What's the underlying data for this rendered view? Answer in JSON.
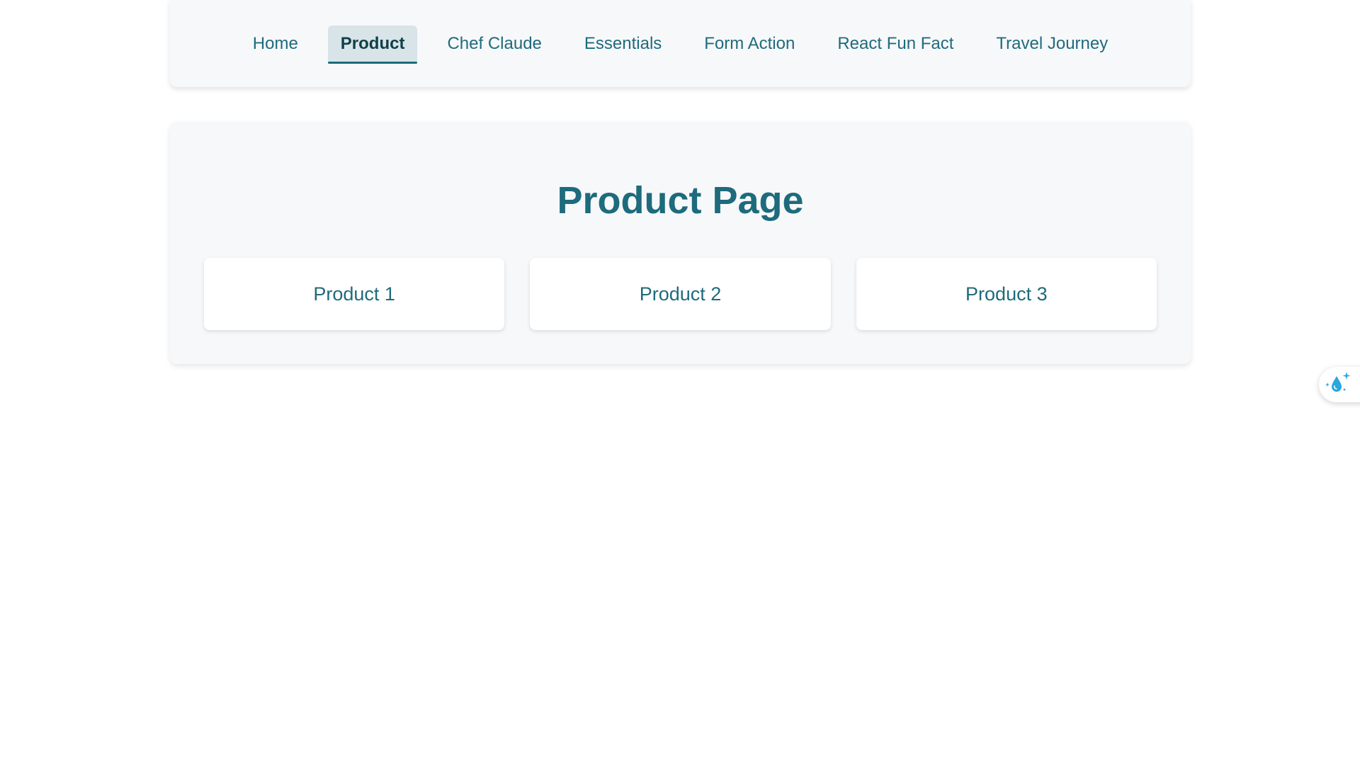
{
  "nav": {
    "items": [
      {
        "label": "Home"
      },
      {
        "label": "Product"
      },
      {
        "label": "Chef Claude"
      },
      {
        "label": "Essentials"
      },
      {
        "label": "Form Action"
      },
      {
        "label": "React Fun Fact"
      },
      {
        "label": "Travel Journey"
      }
    ],
    "active_index": 1
  },
  "main": {
    "title": "Product Page",
    "products": [
      {
        "label": "Product 1"
      },
      {
        "label": "Product 2"
      },
      {
        "label": "Product 3"
      }
    ]
  },
  "widget": {
    "icon": "water-drop-sparkle-icon"
  },
  "colors": {
    "accent": "#1d6b7c",
    "active_bg": "#d8e4e7",
    "card_bg": "#f7f8fa",
    "widget_icon": "#2aa6e0"
  }
}
